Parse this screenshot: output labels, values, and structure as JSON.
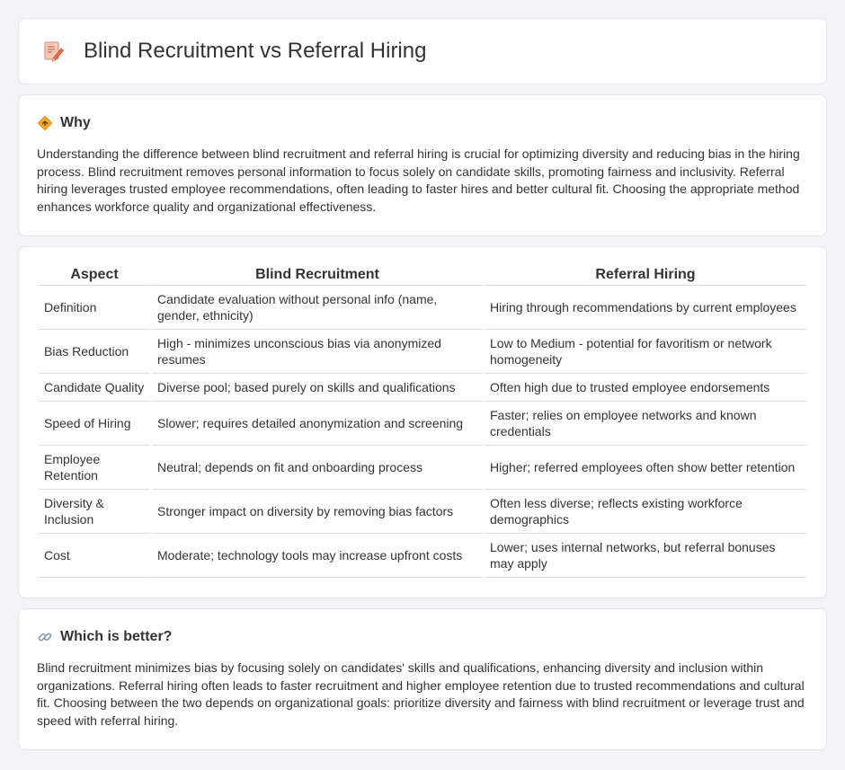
{
  "header": {
    "title": "Blind Recruitment vs Referral Hiring",
    "icon": "document-pencil-icon"
  },
  "why": {
    "title": "Why",
    "icon": "diamond-sign-icon",
    "text": "Understanding the difference between blind recruitment and referral hiring is crucial for optimizing diversity and reducing bias in the hiring process. Blind recruitment removes personal information to focus solely on candidate skills, promoting fairness and inclusivity. Referral hiring leverages trusted employee recommendations, often leading to faster hires and better cultural fit. Choosing the appropriate method enhances workforce quality and organizational effectiveness."
  },
  "table": {
    "headers": [
      "Aspect",
      "Blind Recruitment",
      "Referral Hiring"
    ],
    "rows": [
      [
        "Definition",
        "Candidate evaluation without personal info (name, gender, ethnicity)",
        "Hiring through recommendations by current employees"
      ],
      [
        "Bias Reduction",
        "High - minimizes unconscious bias via anonymized resumes",
        "Low to Medium - potential for favoritism or network homogeneity"
      ],
      [
        "Candidate Quality",
        "Diverse pool; based purely on skills and qualifications",
        "Often high due to trusted employee endorsements"
      ],
      [
        "Speed of Hiring",
        "Slower; requires detailed anonymization and screening",
        "Faster; relies on employee networks and known credentials"
      ],
      [
        "Employee Retention",
        "Neutral; depends on fit and onboarding process",
        "Higher; referred employees often show better retention"
      ],
      [
        "Diversity & Inclusion",
        "Stronger impact on diversity by removing bias factors",
        "Often less diverse; reflects existing workforce demographics"
      ],
      [
        "Cost",
        "Moderate; technology tools may increase upfront costs",
        "Lower; uses internal networks, but referral bonuses may apply"
      ]
    ]
  },
  "better": {
    "title": "Which is better?",
    "icon": "link-icon",
    "text": "Blind recruitment minimizes bias by focusing solely on candidates' skills and qualifications, enhancing diversity and inclusion within organizations. Referral hiring often leads to faster recruitment and higher employee retention due to trusted recommendations and cultural fit. Choosing between the two depends on organizational goals: prioritize diversity and fairness with blind recruitment or leverage trust and speed with referral hiring."
  }
}
